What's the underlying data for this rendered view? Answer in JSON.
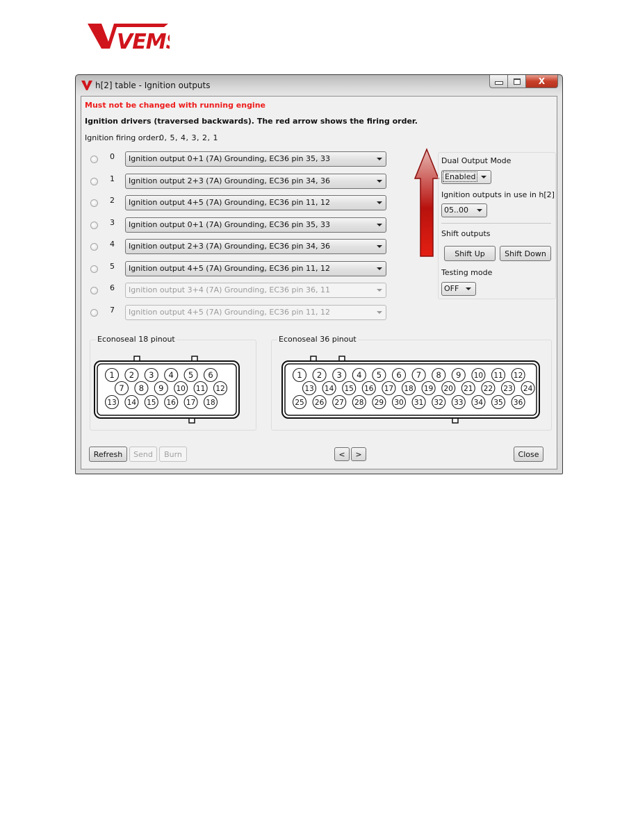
{
  "logo": {
    "text": "VEMS",
    "color": "#d0141c"
  },
  "window": {
    "title": "h[2] table - Ignition outputs",
    "controls": {
      "minimize": "minimize",
      "maximize": "maximize",
      "close": "X"
    }
  },
  "header": {
    "warning": "Must not be changed with running engine",
    "info": "Ignition drivers (traversed backwards). The red arrow shows the firing order.",
    "firing_order_label": "Ignition firing order:",
    "firing_order_value": "0, 5, 4, 3, 2, 1"
  },
  "outputs": [
    {
      "index": "0",
      "value": "Ignition output 0+1 (7A) Grounding, EC36  pin 35, 33",
      "enabled": true
    },
    {
      "index": "1",
      "value": "Ignition output 2+3 (7A) Grounding, EC36  pin 34, 36",
      "enabled": true
    },
    {
      "index": "2",
      "value": "Ignition output 4+5 (7A) Grounding, EC36  pin 11, 12",
      "enabled": true
    },
    {
      "index": "3",
      "value": "Ignition output 0+1 (7A) Grounding, EC36  pin 35, 33",
      "enabled": true
    },
    {
      "index": "4",
      "value": "Ignition output 2+3 (7A) Grounding, EC36  pin 34, 36",
      "enabled": true
    },
    {
      "index": "5",
      "value": "Ignition output 4+5 (7A) Grounding, EC36  pin 11, 12",
      "enabled": true
    },
    {
      "index": "6",
      "value": "Ignition output 3+4 (7A) Grounding, EC36  pin 36, 11",
      "enabled": false
    },
    {
      "index": "7",
      "value": "Ignition output 4+5 (7A) Grounding, EC36  pin 11, 12",
      "enabled": false
    }
  ],
  "firing_arrow": {
    "direction": "up",
    "color": "#d01a10"
  },
  "side_panel": {
    "dual_output_label": "Dual Output Mode",
    "dual_output_value": "Enabled",
    "outputs_in_use_label": "Ignition outputs in use in h[2]",
    "outputs_in_use_value": "05..00",
    "shift_label": "Shift outputs",
    "shift_up": "Shift Up",
    "shift_down": "Shift Down",
    "testing_label": "Testing mode",
    "testing_value": "OFF"
  },
  "pinouts": {
    "ec18": {
      "title": "Econoseal 18 pinout",
      "rows": [
        [
          "1",
          "2",
          "3",
          "4",
          "5",
          "6"
        ],
        [
          "7",
          "8",
          "9",
          "10",
          "11",
          "12"
        ],
        [
          "13",
          "14",
          "15",
          "16",
          "17",
          "18"
        ]
      ]
    },
    "ec36": {
      "title": "Econoseal 36 pinout",
      "rows": [
        [
          "1",
          "2",
          "3",
          "4",
          "5",
          "6",
          "7",
          "8",
          "9",
          "10",
          "11",
          "12"
        ],
        [
          "13",
          "14",
          "15",
          "16",
          "17",
          "18",
          "19",
          "20",
          "21",
          "22",
          "23",
          "24"
        ],
        [
          "25",
          "26",
          "27",
          "28",
          "29",
          "30",
          "31",
          "32",
          "33",
          "34",
          "35",
          "36"
        ]
      ]
    }
  },
  "footer": {
    "refresh": "Refresh",
    "send": "Send",
    "burn": "Burn",
    "prev": "<",
    "next": ">",
    "close": "Close"
  }
}
